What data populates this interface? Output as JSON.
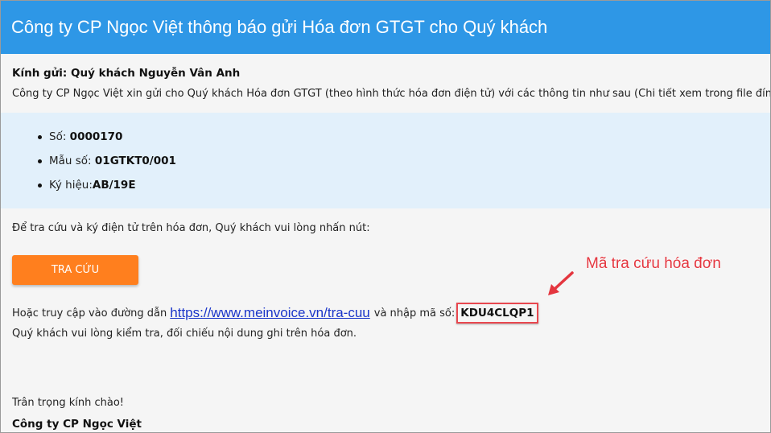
{
  "header": {
    "title": "Công ty CP Ngọc Việt thông báo gửi Hóa đơn GTGT cho Quý khách"
  },
  "letter": {
    "greeting": "Kính gửi: Quý khách Nguyễn Vân Anh",
    "intro": "Công ty CP Ngọc Việt xin gửi cho Quý khách Hóa đơn GTGT (theo hình thức hóa đơn điện tử) với các thông tin như sau (Chi tiết xem trong file đính kèm)",
    "instruction": "Để tra cứu và ký điện tử trên hóa đơn, Quý khách vui lòng nhấn nút:",
    "lookup_button": "TRA CỨU",
    "access_prefix": "Hoặc truy cập vào đường dẫn",
    "link_text": "https://www.meinvoice.vn/tra-cuu",
    "code_label": "và nhập mã số:",
    "lookup_code": "KDU4CLQP1",
    "check_note": "Quý khách vui lòng kiểm tra, đối chiếu nội dung ghi trên hóa đơn.",
    "regards": "Trân trọng kính chào!",
    "signature": "Công ty CP Ngọc Việt"
  },
  "invoice": {
    "number_label": "Số: ",
    "number_value": "0000170",
    "template_label": "Mẫu số: ",
    "template_value": "01GTKT0/001",
    "symbol_label": "Ký hiệu:",
    "symbol_value": "AB/19E"
  },
  "annotation": {
    "text": "Mã tra cứu hóa đơn",
    "icon": "arrow-icon",
    "color": "#e4363f"
  },
  "colors": {
    "header_bg": "#2e97e6",
    "button_bg": "#ff7f1e",
    "info_bg": "#e2f0fb",
    "link": "#1a35c9"
  }
}
